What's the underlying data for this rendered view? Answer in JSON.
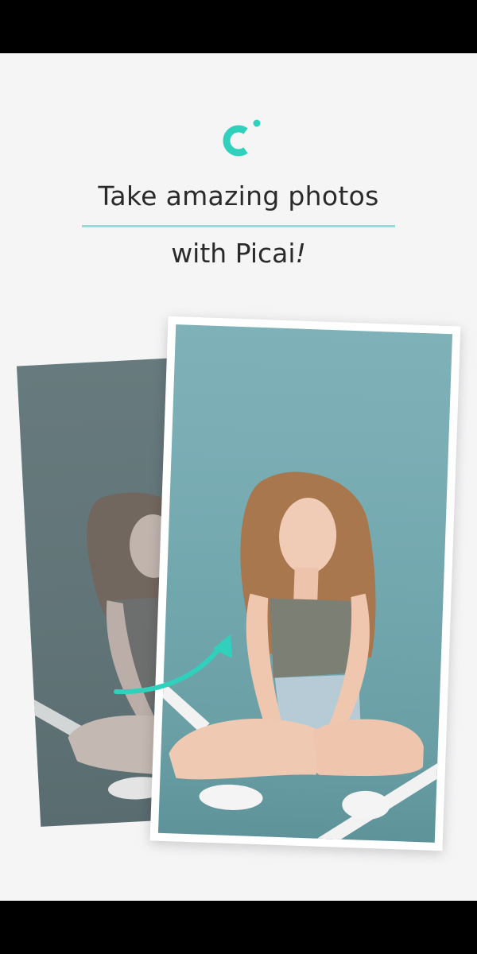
{
  "onboarding": {
    "headline": "Take amazing photos",
    "subline_prefix": "with Picai",
    "subline_suffix": "!"
  },
  "logo": {
    "icon": "picai-logo-icon",
    "color": "#2fd1bd"
  },
  "colors": {
    "accent": "#2fd1bd",
    "divider": "#8fe0d8",
    "background": "#f5f5f6"
  },
  "photos": {
    "before": {
      "description_icon": "before-photo"
    },
    "after": {
      "description_icon": "after-photo"
    }
  }
}
